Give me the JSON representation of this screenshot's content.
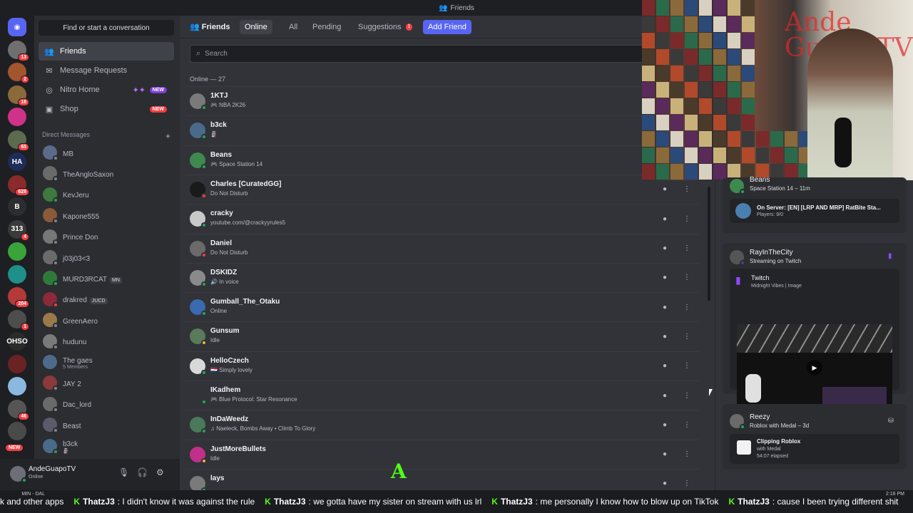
{
  "window": {
    "title": "Friends"
  },
  "servers": [
    {
      "id": "home",
      "label": "",
      "color": "#5865f2",
      "badge": ""
    },
    {
      "id": "s1",
      "label": "",
      "color": "#6f6f6f",
      "badge": "13"
    },
    {
      "id": "s2",
      "label": "",
      "color": "#a3552d",
      "badge": "2"
    },
    {
      "id": "s3",
      "label": "",
      "color": "#8a6a3a",
      "badge": "16"
    },
    {
      "id": "s4",
      "label": "",
      "color": "#d0328a",
      "badge": ""
    },
    {
      "id": "s5",
      "label": "",
      "color": "#5a6b4e",
      "badge": "65"
    },
    {
      "id": "s6",
      "label": "HA",
      "color": "#1e2c5a",
      "badge": ""
    },
    {
      "id": "s7",
      "label": "",
      "color": "#8a2a2a",
      "badge": "628"
    },
    {
      "id": "s8",
      "label": "B",
      "color": "#2b2d31",
      "badge": ""
    },
    {
      "id": "s9",
      "label": "313",
      "color": "#3a3a3a",
      "badge": "4"
    },
    {
      "id": "s10",
      "label": "",
      "color": "#3aa33a",
      "badge": ""
    },
    {
      "id": "s11",
      "label": "",
      "color": "#1f8f8a",
      "badge": ""
    },
    {
      "id": "s12",
      "label": "",
      "color": "#b43a3a",
      "badge": "204"
    },
    {
      "id": "s13",
      "label": "",
      "color": "#4d4d4d",
      "badge": "1"
    },
    {
      "id": "s14",
      "label": "OHSO",
      "color": "#2b2b2b",
      "badge": ""
    },
    {
      "id": "s15",
      "label": "",
      "color": "#6a2222",
      "badge": ""
    },
    {
      "id": "s16",
      "label": "",
      "color": "#8ab8e0",
      "badge": ""
    },
    {
      "id": "s17",
      "label": "",
      "color": "#555555",
      "badge": "46"
    },
    {
      "id": "s18",
      "label": "",
      "color": "#4a4a4a",
      "badge": ""
    }
  ],
  "rail_new_badge": "NEW",
  "sidebar": {
    "find_label": "Find or start a conversation",
    "nav": [
      {
        "label": "Friends",
        "icon": "friends-icon",
        "glyph": "👥",
        "badge": "",
        "active": true
      },
      {
        "label": "Message Requests",
        "icon": "mail-icon",
        "glyph": "✉",
        "badge": "",
        "active": false
      },
      {
        "label": "Nitro Home",
        "icon": "nitro-icon",
        "glyph": "◎",
        "badge": "NEW",
        "active": false
      },
      {
        "label": "Shop",
        "icon": "shop-icon",
        "glyph": "▣",
        "badge": "NEW",
        "active": false
      }
    ],
    "dm_header": "Direct Messages",
    "dm_add": "+",
    "dms": [
      {
        "name": "MB",
        "sub": "",
        "tag": "",
        "color": "#5b6b8a",
        "status": "#80848e"
      },
      {
        "name": "TheAngloSaxon",
        "sub": "",
        "tag": "",
        "color": "#6a6a6a",
        "status": "#80848e"
      },
      {
        "name": "KevJeru",
        "sub": "",
        "tag": "",
        "color": "#3e7a3e",
        "status": "#23a55a"
      },
      {
        "name": "Kapone555",
        "sub": "",
        "tag": "",
        "color": "#8a5a3a",
        "status": "#80848e"
      },
      {
        "name": "Prince Don",
        "sub": "",
        "tag": "",
        "color": "#777777",
        "status": "#80848e"
      },
      {
        "name": "j03j03<3",
        "sub": "",
        "tag": "",
        "color": "#6b6b6b",
        "status": "#80848e"
      },
      {
        "name": "MURD3RCAT",
        "sub": "",
        "tag": "MN",
        "color": "#2f7a3a",
        "status": "#23a55a"
      },
      {
        "name": "drakred",
        "sub": "",
        "tag": "JUCD",
        "color": "#8a2a3a",
        "status": "#f23f43"
      },
      {
        "name": "GreenAero",
        "sub": "",
        "tag": "",
        "color": "#9a7a4a",
        "status": "#80848e"
      },
      {
        "name": "hudunu",
        "sub": "",
        "tag": "",
        "color": "#7a7a7a",
        "status": "#80848e"
      },
      {
        "name": "The gaes",
        "sub": "5 Members",
        "tag": "",
        "color": "#4e6a8a",
        "status": ""
      },
      {
        "name": "JAY 2",
        "sub": "",
        "tag": "",
        "color": "#8a3a3a",
        "status": "#80848e"
      },
      {
        "name": "Dac_lord",
        "sub": "",
        "tag": "",
        "color": "#6a6a6a",
        "status": "#80848e"
      },
      {
        "name": "Beast",
        "sub": "",
        "tag": "",
        "color": "#5a5a6a",
        "status": "#80848e"
      },
      {
        "name": "b3ck",
        "sub": "🗿",
        "tag": "",
        "color": "#4a6a8a",
        "status": "#23a55a"
      }
    ]
  },
  "user_panel": {
    "name": "AndeGuapoTV",
    "status": "Online"
  },
  "main": {
    "header_title": "Friends",
    "tabs": [
      {
        "label": "Online",
        "selected": true
      },
      {
        "label": "All",
        "selected": false
      },
      {
        "label": "Pending",
        "selected": false
      },
      {
        "label": "Suggestions",
        "selected": false,
        "count": "1"
      }
    ],
    "add_friend": "Add Friend",
    "search_placeholder": "Search",
    "online_count": "Online — 27",
    "friends": [
      {
        "name": "1KTJ",
        "activity": "🎮 NBA 2K26",
        "color": "#7a7a7a",
        "status": "#23a55a"
      },
      {
        "name": "b3ck",
        "activity": "🗿",
        "color": "#4a6a8a",
        "status": "#23a55a"
      },
      {
        "name": "Beans",
        "activity": "🎮 Space Station 14",
        "color": "#3e8a4e",
        "status": "#23a55a"
      },
      {
        "name": "Charles [CuratedGG]",
        "activity": "Do Not Disturb",
        "color": "#1a1a1a",
        "status": "#f23f43"
      },
      {
        "name": "cracky",
        "activity": "youtube.com/@crackyyrules5",
        "color": "#c9c9c9",
        "status": "#23a55a"
      },
      {
        "name": "Daniel",
        "activity": "Do Not Disturb",
        "color": "#6a6a6a",
        "status": "#f23f43"
      },
      {
        "name": "DSKIDZ",
        "activity": "🔊 In voice",
        "color": "#8a8a8a",
        "status": "#23a55a"
      },
      {
        "name": "Gumball_The_Otaku",
        "activity": "Online",
        "color": "#3a6ab0",
        "status": "#23a55a"
      },
      {
        "name": "Gunsum",
        "activity": "Idle",
        "color": "#5a7a5a",
        "status": "#f0b232"
      },
      {
        "name": "HelloCzech",
        "activity": "🇳🇱 Simply lovely",
        "color": "#d8d8d8",
        "status": "#23a55a"
      },
      {
        "name": "IKadhem",
        "activity": "🎮 Blue Protocol: Star Resonance",
        "color": "#313338",
        "status": "#23a55a"
      },
      {
        "name": "InDaWeedz",
        "activity": "♫ Naeleck, Bombs Away • Climb To Glory",
        "color": "#4a7a5a",
        "status": "#23a55a"
      },
      {
        "name": "JustMoreBullets",
        "activity": "Idle",
        "color": "#c0308a",
        "status": "#f0b232"
      },
      {
        "name": "lays",
        "activity": "",
        "color": "#7a7a7a",
        "status": "#23a55a"
      }
    ]
  },
  "activity_panel": {
    "beans_card": {
      "name": "Beans",
      "status": "Space Station 14 – 11m",
      "server_title": "On Server: [EN] [LRP AND MRP] RatBite Sta...",
      "server_sub": "Players: 9/0"
    },
    "ray_card": {
      "name": "RayInTheCity",
      "status": "Streaming on Twitch",
      "platform": "Twitch",
      "stream_title": "Midnight Vibes | Image"
    },
    "reezy_card": {
      "name": "Reezy",
      "status": "Roblox with Medal – 3d",
      "title": "Clipping Roblox",
      "sub1": "with Medal",
      "sub2": "54:07 elapsed"
    }
  },
  "chat_ticker": [
    {
      "user": "",
      "text": "k and other apps"
    },
    {
      "user": "ThatzJ3",
      "text": ": I didn't know it was against the rule"
    },
    {
      "user": "ThatzJ3",
      "text": ": we gotta have my sister on stream with us lrl"
    },
    {
      "user": "ThatzJ3",
      "text": ": me personally I know how to blow up on TikTok"
    },
    {
      "user": "ThatzJ3",
      "text": ": cause I been trying different shit"
    }
  ],
  "tray": {
    "weather": "MIN - DAL",
    "time": "2:16 PM"
  },
  "overlay_letter": "A",
  "cam_overlay_text": "Ande Guapo TV",
  "colors": {
    "accent": "#5865f2",
    "online": "#23a55a",
    "dnd": "#f23f43",
    "idle": "#f0b232",
    "kick_green": "#53fc18",
    "twitch": "#9146ff"
  }
}
